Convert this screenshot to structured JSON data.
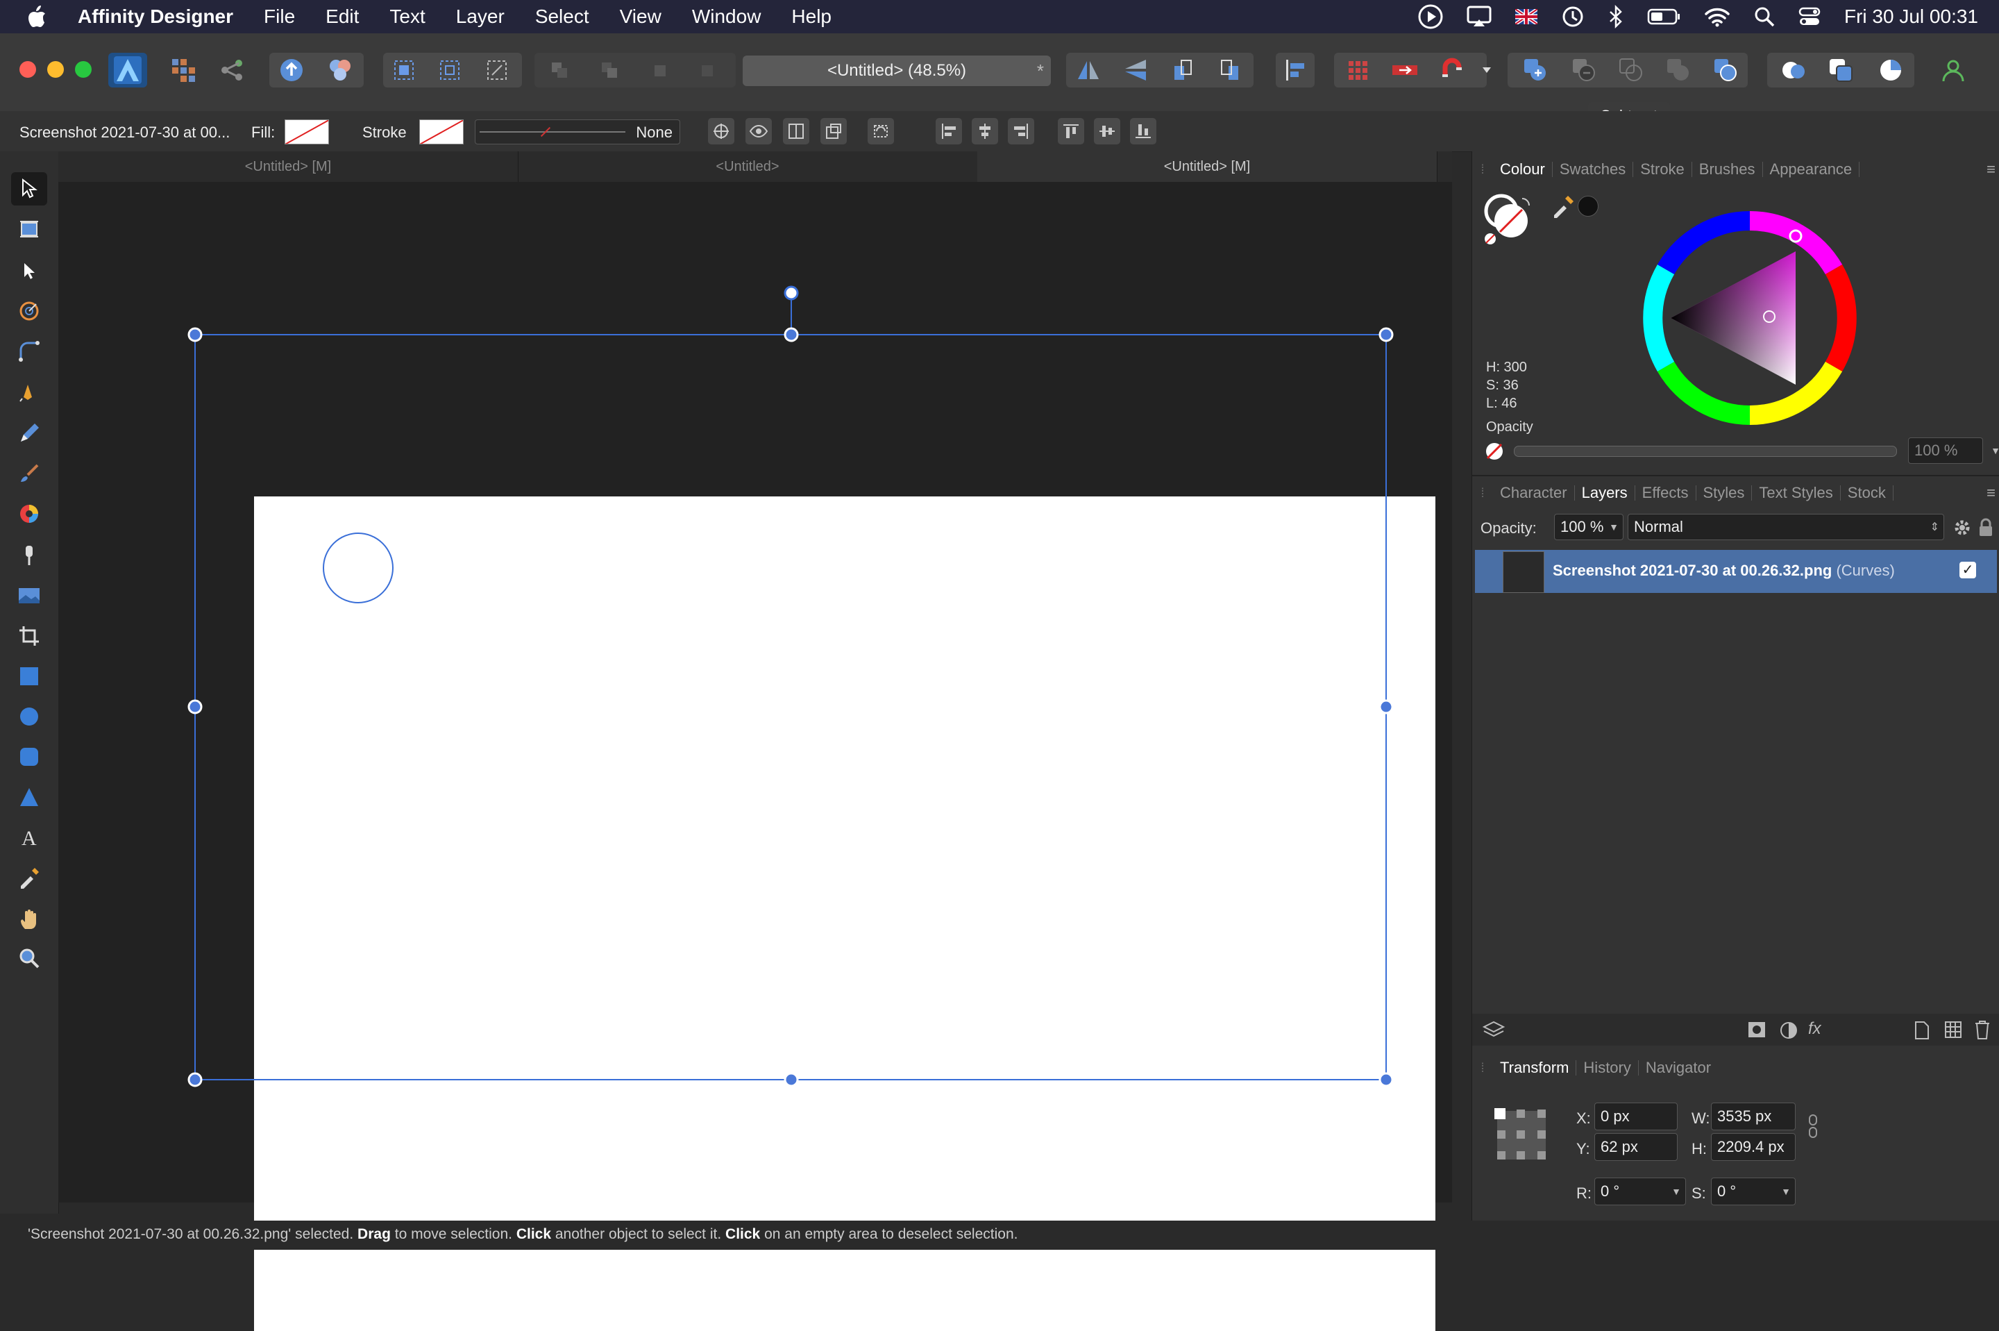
{
  "menubar": {
    "app_name": "Affinity Designer",
    "items": [
      "File",
      "Edit",
      "Text",
      "Layer",
      "Select",
      "View",
      "Window",
      "Help"
    ],
    "datetime": "Fri 30 Jul  00:31"
  },
  "toolbar": {
    "doc_title": "<Untitled> (48.5%)",
    "modified_marker": "*",
    "tooltip": "Subtract"
  },
  "context": {
    "selection_name": "Screenshot 2021-07-30 at 00...",
    "fill_label": "Fill:",
    "stroke_label": "Stroke",
    "stroke_width": "None"
  },
  "doc_tabs": [
    "<Untitled> [M]",
    "<Untitled>",
    "<Untitled> [M]"
  ],
  "colour_panel": {
    "tabs": [
      "Colour",
      "Swatches",
      "Stroke",
      "Brushes",
      "Appearance"
    ],
    "h": "H: 300",
    "s": "S: 36",
    "l": "L: 46",
    "opacity_label": "Opacity",
    "opacity_value": "100 %"
  },
  "layers_panel": {
    "tabs": [
      "Character",
      "Layers",
      "Effects",
      "Styles",
      "Text Styles",
      "Stock"
    ],
    "opacity_label": "Opacity:",
    "opacity_value": "100 %",
    "blend_mode": "Normal",
    "layer_name": "Screenshot 2021-07-30 at 00.26.32.png",
    "layer_type": "(Curves)"
  },
  "transform_panel": {
    "tabs": [
      "Transform",
      "History",
      "Navigator"
    ],
    "x_label": "X:",
    "x_value": "0 px",
    "y_label": "Y:",
    "y_value": "62 px",
    "w_label": "W:",
    "w_value": "3535 px",
    "h_label": "H:",
    "h_value": "2209.4 px",
    "r_label": "R:",
    "r_value": "0 °",
    "s_label": "S:",
    "s_value": "0 °"
  },
  "statusbar": {
    "selected_text": "'Screenshot 2021-07-30 at 00.26.32.png' selected.",
    "drag": "Drag",
    "drag_rest": " to move selection.",
    "click1": "Click",
    "click1_rest": " another object to select it.",
    "click2": "Click",
    "click2_rest": " on an empty area to deselect selection."
  },
  "colors": {
    "accent": "#4a78d8",
    "selection": "#3a6fd8",
    "layer_highlight": "#4a6fa5"
  }
}
